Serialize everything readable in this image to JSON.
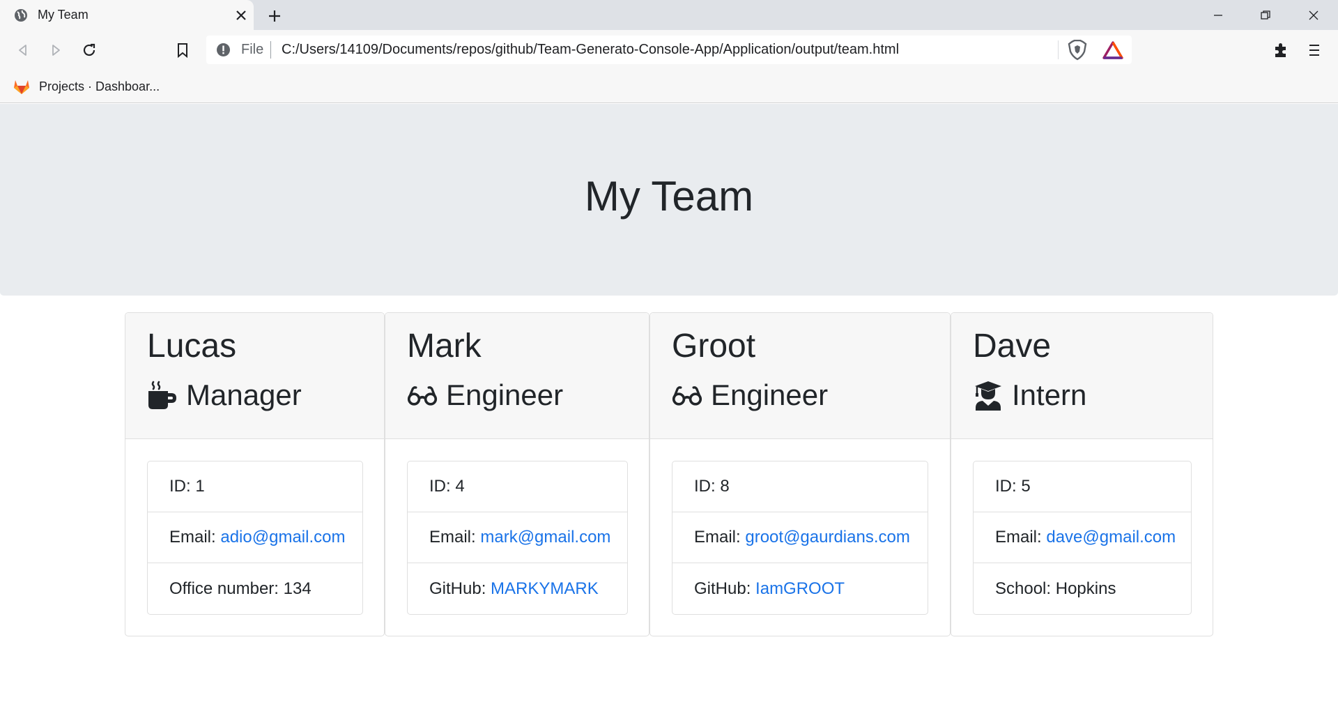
{
  "browser": {
    "tab_title": "My Team",
    "url_scheme": "File",
    "url": "C:/Users/14109/Documents/repos/github/Team-Generato-Console-App/Application/output/team.html",
    "bookmark_label": "Projects · Dashboar..."
  },
  "page": {
    "heading": "My Team"
  },
  "cards": [
    {
      "name": "Lucas",
      "role": "Manager",
      "role_icon": "coffee-mug-icon",
      "id_label": "ID:",
      "id_value": "1",
      "email_label": "Email:",
      "email": "adio@gmail.com",
      "extra_label": "Office number:",
      "extra_value": "134"
    },
    {
      "name": "Mark",
      "role": "Engineer",
      "role_icon": "glasses-icon",
      "id_label": "ID:",
      "id_value": "4",
      "email_label": "Email:",
      "email": "mark@gmail.com",
      "extra_label": "GitHub:",
      "extra_value": "MARKYMARK"
    },
    {
      "name": "Groot",
      "role": "Engineer",
      "role_icon": "glasses-icon",
      "id_label": "ID:",
      "id_value": "8",
      "email_label": "Email:",
      "email": "groot@gaurdians.com",
      "extra_label": "GitHub:",
      "extra_value": "IamGROOT"
    },
    {
      "name": "Dave",
      "role": "Intern",
      "role_icon": "graduate-icon",
      "id_label": "ID:",
      "id_value": "5",
      "email_label": "Email:",
      "email": "dave@gmail.com",
      "extra_label": "School:",
      "extra_value": "Hopkins"
    }
  ],
  "colors": {
    "link": "#1a73e8",
    "jumbotron_bg": "#e9ecef",
    "card_header_bg": "#f7f7f7",
    "text": "#212529"
  }
}
